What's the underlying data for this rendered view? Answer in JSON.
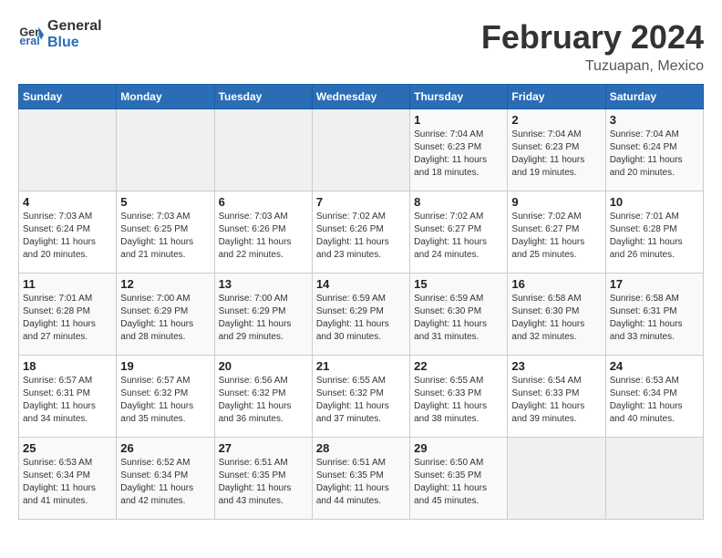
{
  "header": {
    "logo_line1": "General",
    "logo_line2": "Blue",
    "month": "February 2024",
    "location": "Tuzuapan, Mexico"
  },
  "days_of_week": [
    "Sunday",
    "Monday",
    "Tuesday",
    "Wednesday",
    "Thursday",
    "Friday",
    "Saturday"
  ],
  "weeks": [
    [
      {
        "day": "",
        "info": ""
      },
      {
        "day": "",
        "info": ""
      },
      {
        "day": "",
        "info": ""
      },
      {
        "day": "",
        "info": ""
      },
      {
        "day": "1",
        "info": "Sunrise: 7:04 AM\nSunset: 6:23 PM\nDaylight: 11 hours\nand 18 minutes."
      },
      {
        "day": "2",
        "info": "Sunrise: 7:04 AM\nSunset: 6:23 PM\nDaylight: 11 hours\nand 19 minutes."
      },
      {
        "day": "3",
        "info": "Sunrise: 7:04 AM\nSunset: 6:24 PM\nDaylight: 11 hours\nand 20 minutes."
      }
    ],
    [
      {
        "day": "4",
        "info": "Sunrise: 7:03 AM\nSunset: 6:24 PM\nDaylight: 11 hours\nand 20 minutes."
      },
      {
        "day": "5",
        "info": "Sunrise: 7:03 AM\nSunset: 6:25 PM\nDaylight: 11 hours\nand 21 minutes."
      },
      {
        "day": "6",
        "info": "Sunrise: 7:03 AM\nSunset: 6:26 PM\nDaylight: 11 hours\nand 22 minutes."
      },
      {
        "day": "7",
        "info": "Sunrise: 7:02 AM\nSunset: 6:26 PM\nDaylight: 11 hours\nand 23 minutes."
      },
      {
        "day": "8",
        "info": "Sunrise: 7:02 AM\nSunset: 6:27 PM\nDaylight: 11 hours\nand 24 minutes."
      },
      {
        "day": "9",
        "info": "Sunrise: 7:02 AM\nSunset: 6:27 PM\nDaylight: 11 hours\nand 25 minutes."
      },
      {
        "day": "10",
        "info": "Sunrise: 7:01 AM\nSunset: 6:28 PM\nDaylight: 11 hours\nand 26 minutes."
      }
    ],
    [
      {
        "day": "11",
        "info": "Sunrise: 7:01 AM\nSunset: 6:28 PM\nDaylight: 11 hours\nand 27 minutes."
      },
      {
        "day": "12",
        "info": "Sunrise: 7:00 AM\nSunset: 6:29 PM\nDaylight: 11 hours\nand 28 minutes."
      },
      {
        "day": "13",
        "info": "Sunrise: 7:00 AM\nSunset: 6:29 PM\nDaylight: 11 hours\nand 29 minutes."
      },
      {
        "day": "14",
        "info": "Sunrise: 6:59 AM\nSunset: 6:29 PM\nDaylight: 11 hours\nand 30 minutes."
      },
      {
        "day": "15",
        "info": "Sunrise: 6:59 AM\nSunset: 6:30 PM\nDaylight: 11 hours\nand 31 minutes."
      },
      {
        "day": "16",
        "info": "Sunrise: 6:58 AM\nSunset: 6:30 PM\nDaylight: 11 hours\nand 32 minutes."
      },
      {
        "day": "17",
        "info": "Sunrise: 6:58 AM\nSunset: 6:31 PM\nDaylight: 11 hours\nand 33 minutes."
      }
    ],
    [
      {
        "day": "18",
        "info": "Sunrise: 6:57 AM\nSunset: 6:31 PM\nDaylight: 11 hours\nand 34 minutes."
      },
      {
        "day": "19",
        "info": "Sunrise: 6:57 AM\nSunset: 6:32 PM\nDaylight: 11 hours\nand 35 minutes."
      },
      {
        "day": "20",
        "info": "Sunrise: 6:56 AM\nSunset: 6:32 PM\nDaylight: 11 hours\nand 36 minutes."
      },
      {
        "day": "21",
        "info": "Sunrise: 6:55 AM\nSunset: 6:32 PM\nDaylight: 11 hours\nand 37 minutes."
      },
      {
        "day": "22",
        "info": "Sunrise: 6:55 AM\nSunset: 6:33 PM\nDaylight: 11 hours\nand 38 minutes."
      },
      {
        "day": "23",
        "info": "Sunrise: 6:54 AM\nSunset: 6:33 PM\nDaylight: 11 hours\nand 39 minutes."
      },
      {
        "day": "24",
        "info": "Sunrise: 6:53 AM\nSunset: 6:34 PM\nDaylight: 11 hours\nand 40 minutes."
      }
    ],
    [
      {
        "day": "25",
        "info": "Sunrise: 6:53 AM\nSunset: 6:34 PM\nDaylight: 11 hours\nand 41 minutes."
      },
      {
        "day": "26",
        "info": "Sunrise: 6:52 AM\nSunset: 6:34 PM\nDaylight: 11 hours\nand 42 minutes."
      },
      {
        "day": "27",
        "info": "Sunrise: 6:51 AM\nSunset: 6:35 PM\nDaylight: 11 hours\nand 43 minutes."
      },
      {
        "day": "28",
        "info": "Sunrise: 6:51 AM\nSunset: 6:35 PM\nDaylight: 11 hours\nand 44 minutes."
      },
      {
        "day": "29",
        "info": "Sunrise: 6:50 AM\nSunset: 6:35 PM\nDaylight: 11 hours\nand 45 minutes."
      },
      {
        "day": "",
        "info": ""
      },
      {
        "day": "",
        "info": ""
      }
    ]
  ]
}
